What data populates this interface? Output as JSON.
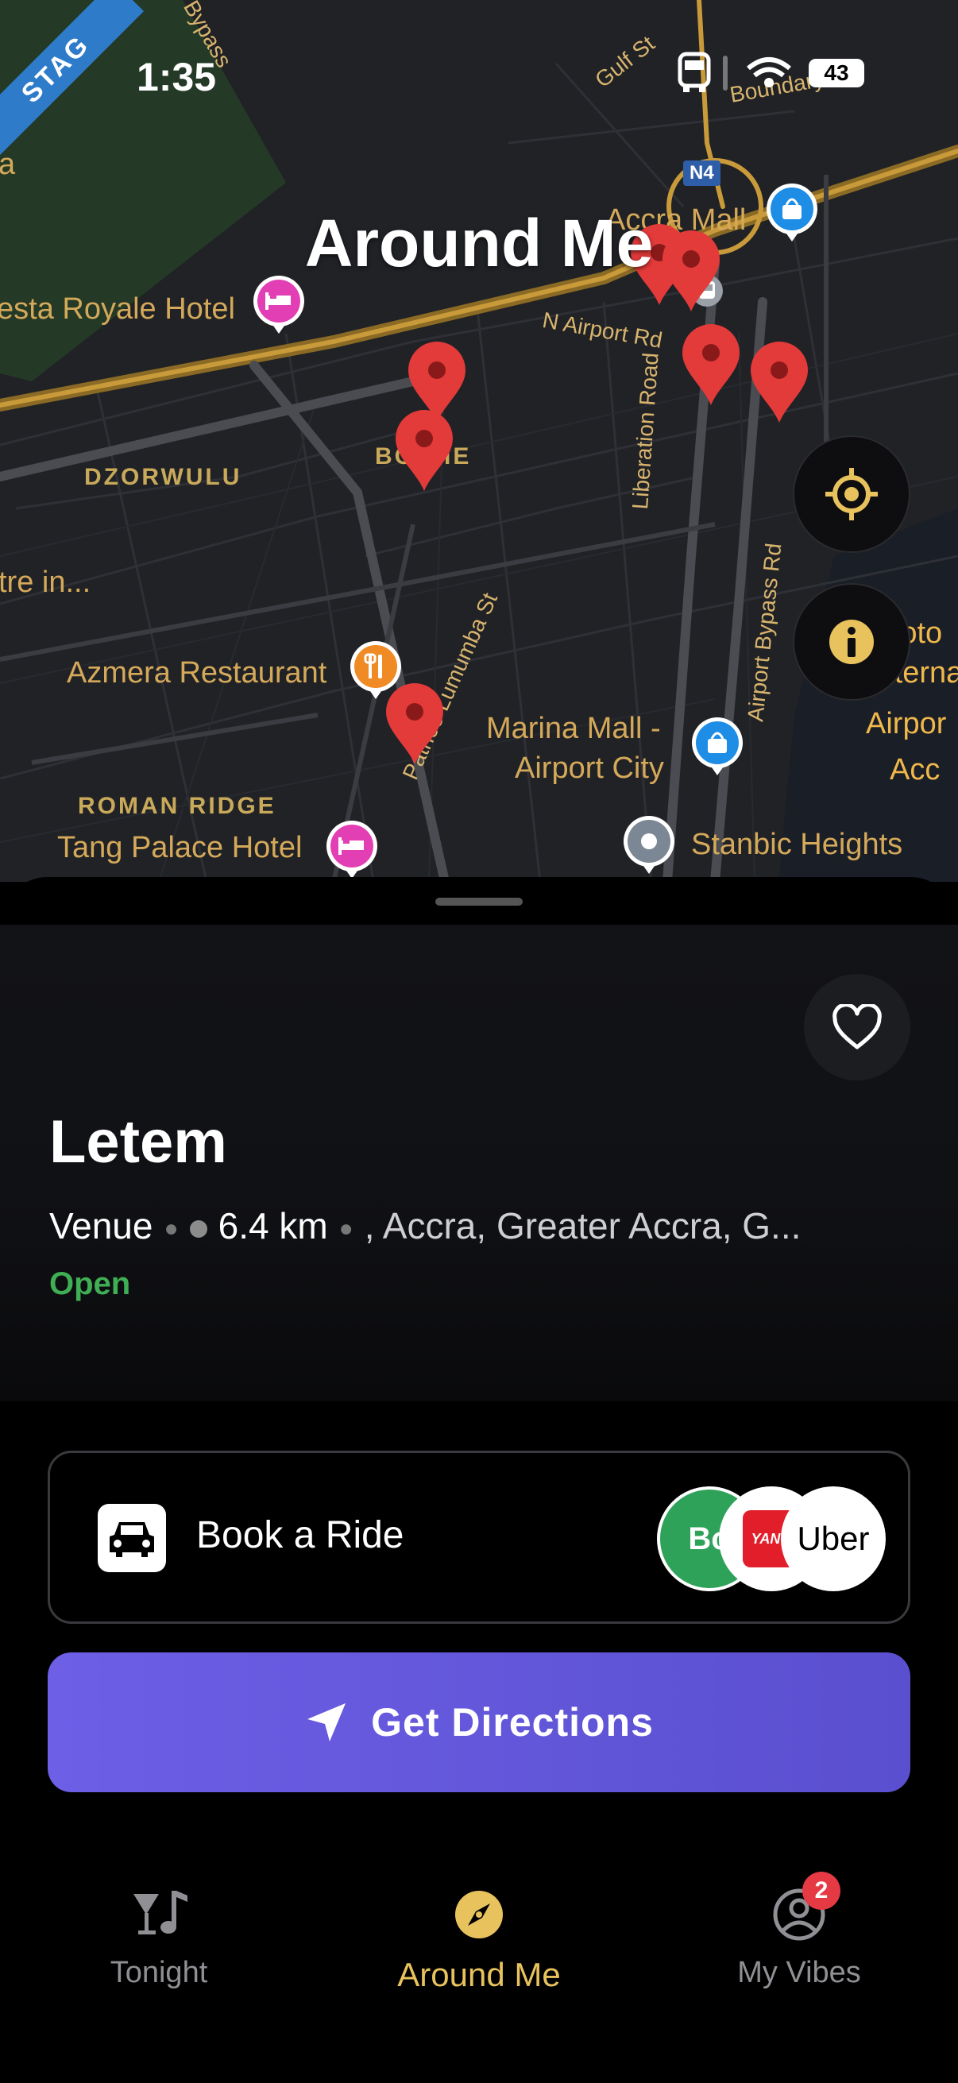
{
  "status_bar": {
    "time": "1:35",
    "battery": "43"
  },
  "env_ribbon": "STAG",
  "map": {
    "title": "Around Me",
    "labels": {
      "gulf_st": "Gulf St",
      "boundary_rd": "Boundary Rd",
      "bypass": "on Bypass",
      "n4": "N4",
      "accra_mall": "Accra Mall",
      "n_airport_rd": "N Airport Rd",
      "fiesta_royale": "esta Royale Hotel",
      "dzorwulu": "DZORWULU",
      "airport_res": "BO   KIE",
      "centre": "tre in...",
      "liberation_road": "Liberation Road",
      "airport_bypass_rd": "Airport Bypass Rd",
      "azmera": "Azmera Restaurant",
      "patrice_st": "Patrice Lumumba St",
      "marina_mall_1": "Marina Mall -",
      "marina_mall_2": "Airport City",
      "roman_ridge": "ROMAN RIDGE",
      "tang_palace": "Tang Palace Hotel",
      "stanbic": "Stanbic Heights",
      "kotoka_1": "Koto",
      "kotoka_2": "Internat",
      "kotoka_3": "Airpor",
      "kotoka_4": "Acc",
      "left_edge": "a"
    }
  },
  "venue": {
    "name": "Letem",
    "type": "Venue",
    "distance": "6.4 km",
    "address": ", Accra, Greater Accra, G...",
    "status": "Open"
  },
  "ride": {
    "label": "Book a Ride",
    "providers": [
      "Bolt",
      "YANGO",
      "Uber"
    ],
    "provider_short": [
      "Bo",
      "YANG",
      "Uber"
    ]
  },
  "directions": {
    "label": "Get Directions"
  },
  "nav": {
    "items": [
      {
        "label": "Tonight",
        "icon": "music-drink-icon"
      },
      {
        "label": "Around Me",
        "icon": "compass-icon"
      },
      {
        "label": "My Vibes",
        "icon": "profile-icon"
      }
    ],
    "active": "Around Me",
    "vibes_badge": "2"
  },
  "colors": {
    "accent": "#e8c25c",
    "primary_button": "#6457dc",
    "open_status": "#3fae54",
    "pin_red": "#e33a3a",
    "badge_red": "#e53944"
  }
}
